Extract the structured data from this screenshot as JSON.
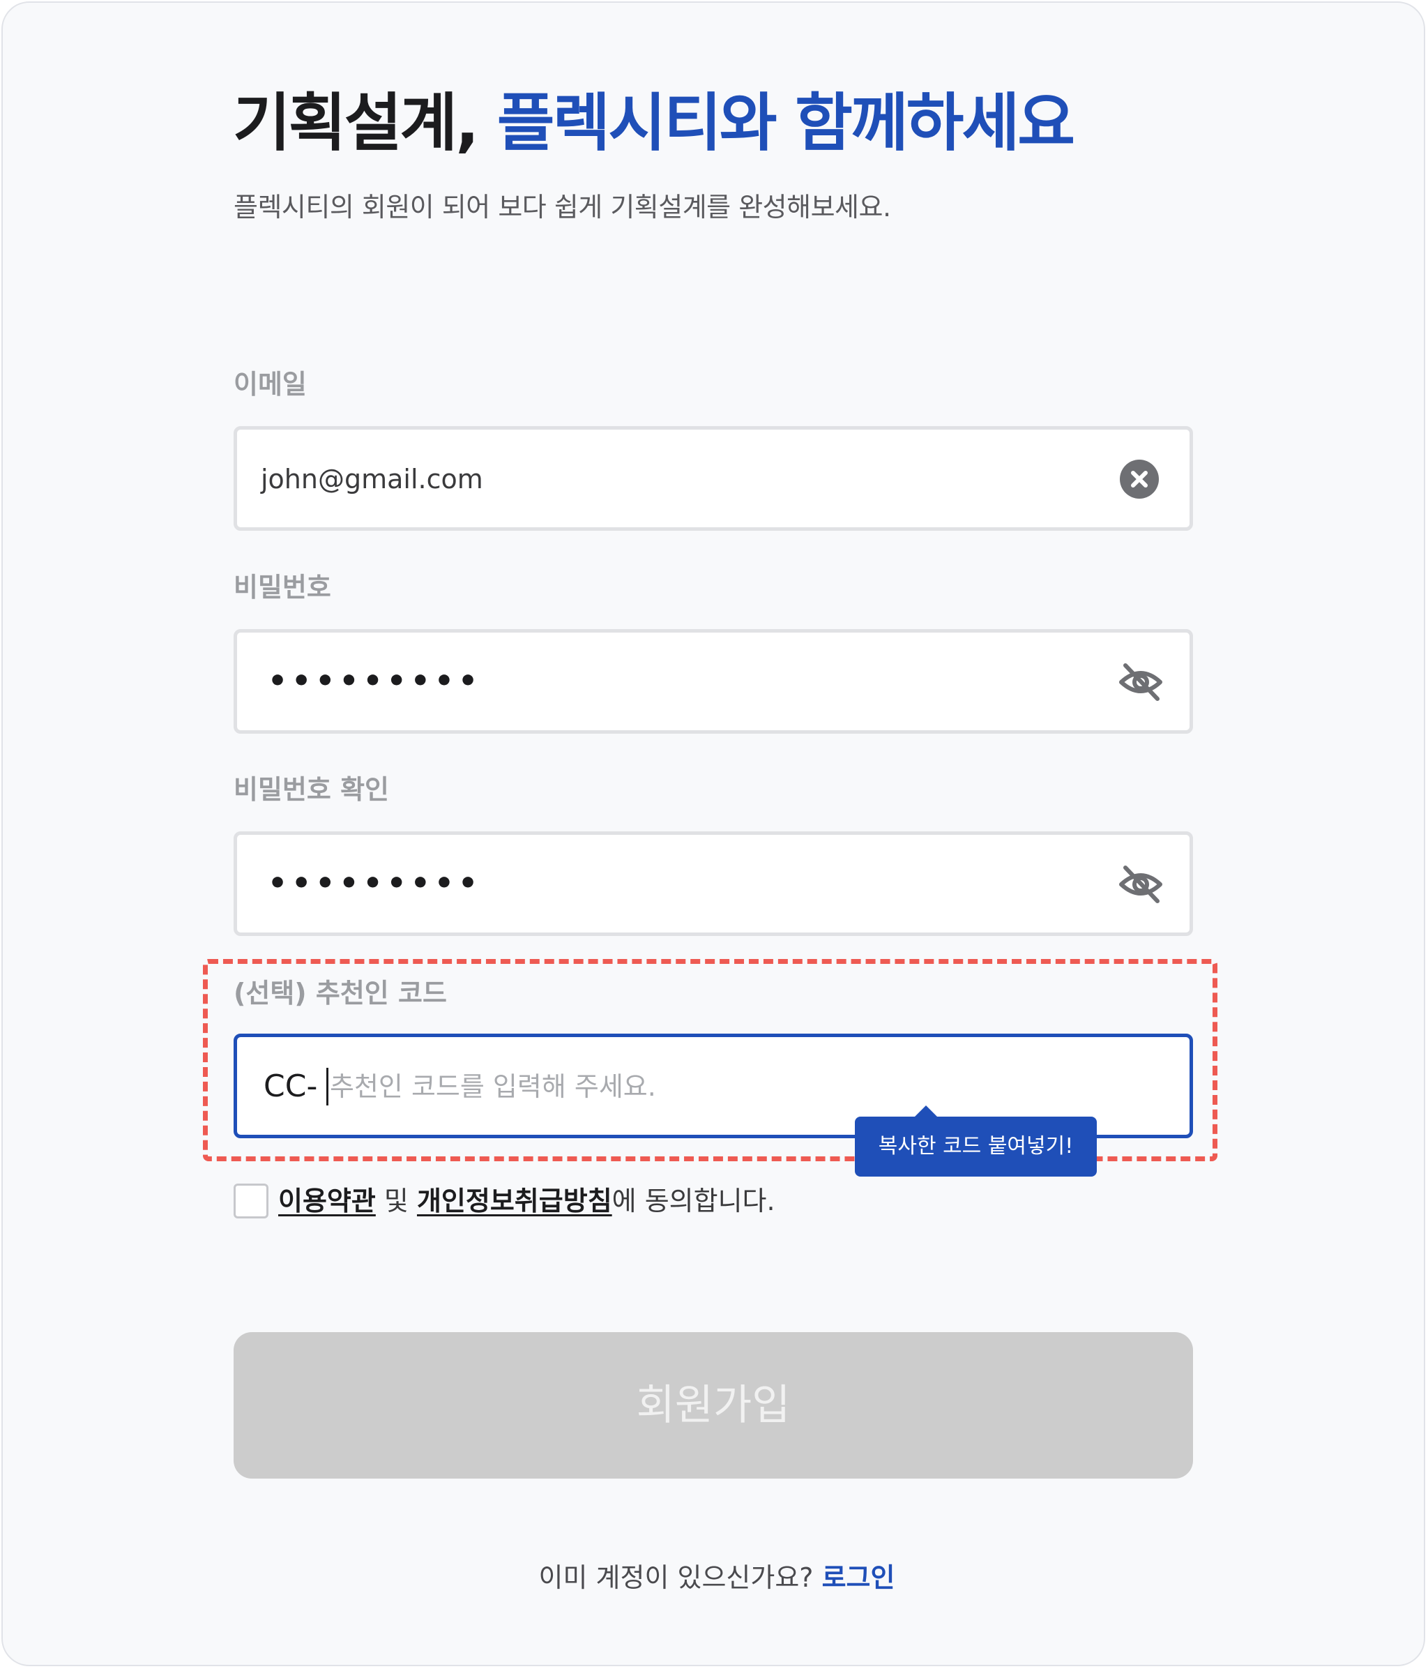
{
  "header": {
    "title_main": "기획설계, ",
    "title_accent": "플렉시티와 함께하세요",
    "subtitle": "플렉시티의 회원이 되어 보다 쉽게 기획설계를 완성해보세요."
  },
  "form": {
    "email": {
      "label": "이메일",
      "value": "john@gmail.com",
      "clear_icon": "clear-circle-icon"
    },
    "password": {
      "label": "비밀번호",
      "masked_value": "•••••••••",
      "toggle_icon": "eye-off-icon"
    },
    "password_confirm": {
      "label": "비밀번호 확인",
      "masked_value": "•••••••••",
      "toggle_icon": "eye-off-icon"
    },
    "referral": {
      "label": "(선택) 추천인 코드",
      "prefix": "CC-",
      "placeholder": "추천인 코드를 입력해 주세요.",
      "tooltip": "복사한 코드 붙여넣기!",
      "highlight_color": "#ee5a52"
    },
    "agreement": {
      "terms_link": "이용약관",
      "conjunction": " 및 ",
      "privacy_link": "개인정보취급방침",
      "suffix": "에 동의합니다.",
      "checked": false
    },
    "submit_label": "회원가입"
  },
  "footer": {
    "question": "이미 계정이 있으신가요? ",
    "login_link": "로그인"
  },
  "colors": {
    "accent": "#1f4fb8",
    "disabled_button": "#cccccc",
    "background": "#f8f9fb"
  }
}
